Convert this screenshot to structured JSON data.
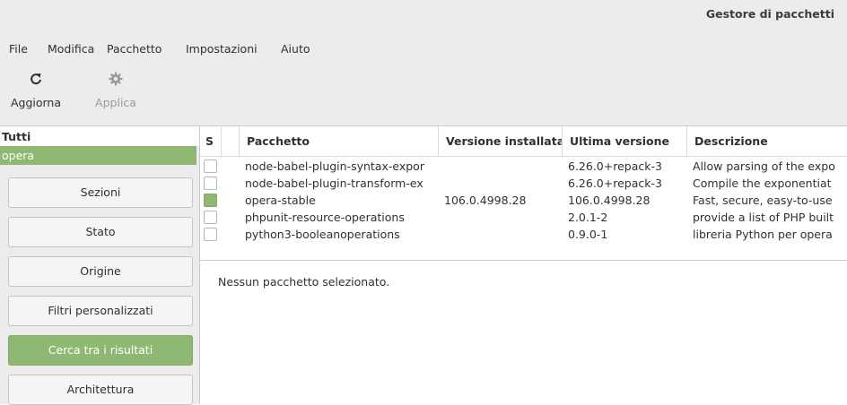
{
  "window": {
    "title": "Gestore di pacchetti"
  },
  "menu": [
    "File",
    "Modifica",
    "Pacchetto",
    "Impostazioni",
    "Aiuto"
  ],
  "toolbar": {
    "reload": {
      "label": "Aggiorna",
      "icon": "reload-icon"
    },
    "apply": {
      "label": "Applica",
      "icon": "gear-icon"
    }
  },
  "sidebar": {
    "filter_header": "Tutti",
    "filter_selected": "opera",
    "buttons": [
      "Sezioni",
      "Stato",
      "Origine",
      "Filtri personalizzati",
      "Cerca tra i risultati",
      "Architettura"
    ],
    "active_button": "Cerca tra i risultati"
  },
  "table": {
    "columns": [
      "S",
      "Pacchetto",
      "Versione installata",
      "Ultima versione",
      "Descrizione"
    ],
    "rows": [
      {
        "installed": false,
        "package": "node-babel-plugin-syntax-expor",
        "installed_version": "",
        "latest_version": "6.26.0+repack-3",
        "description": "Allow parsing of the expo"
      },
      {
        "installed": false,
        "package": "node-babel-plugin-transform-ex",
        "installed_version": "",
        "latest_version": "6.26.0+repack-3",
        "description": "Compile the exponentiat"
      },
      {
        "installed": true,
        "package": "opera-stable",
        "installed_version": "106.0.4998.28",
        "latest_version": "106.0.4998.28",
        "description": "Fast, secure, easy-to-use"
      },
      {
        "installed": false,
        "package": "phpunit-resource-operations",
        "installed_version": "",
        "latest_version": "2.0.1-2",
        "description": "provide a list of PHP built"
      },
      {
        "installed": false,
        "package": "python3-booleanoperations",
        "installed_version": "",
        "latest_version": "0.9.0-1",
        "description": "libreria Python per opera"
      }
    ]
  },
  "details": {
    "text": "Nessun pacchetto selezionato."
  },
  "colors": {
    "accent": "#8fb872",
    "background": "#ececec"
  }
}
